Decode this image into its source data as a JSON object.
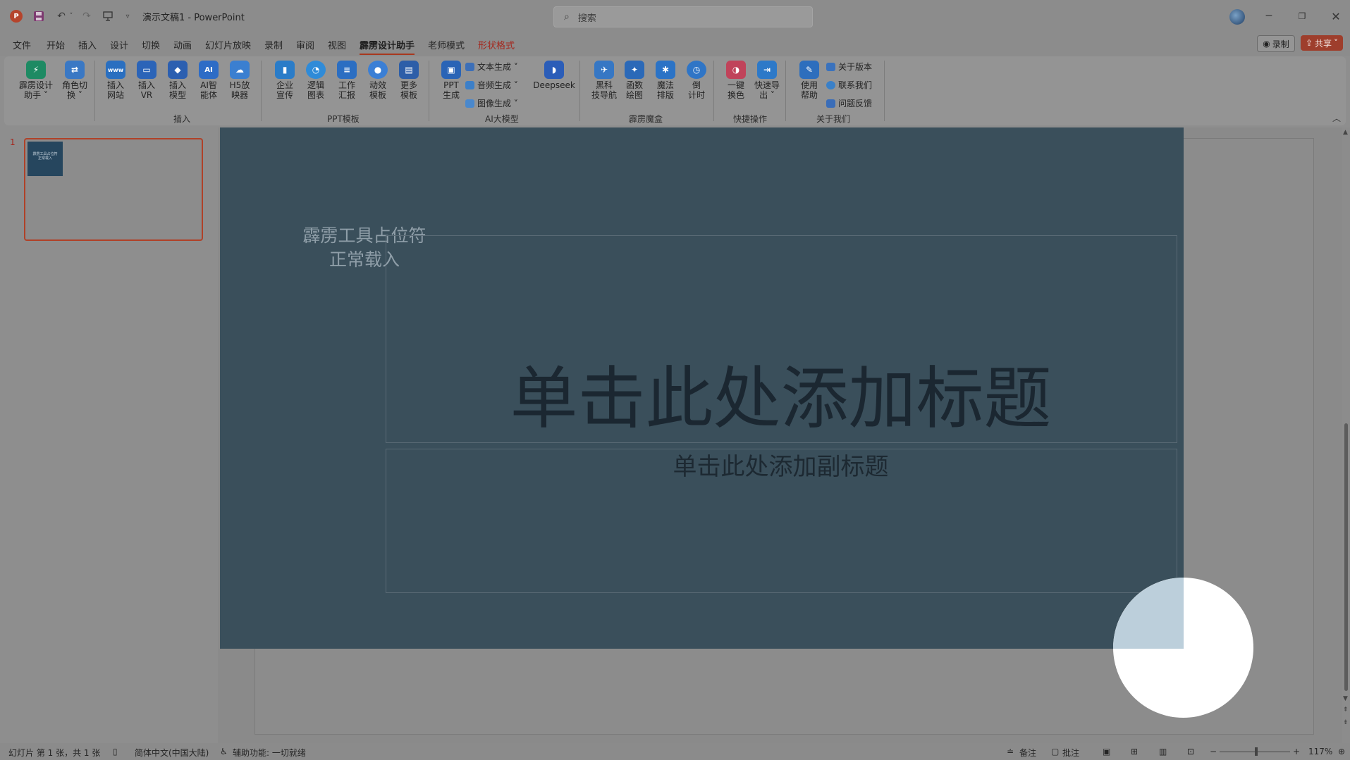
{
  "titlebar": {
    "app_logo": "P",
    "doc_title": "演示文稿1  -  PowerPoint",
    "search_placeholder": "搜索",
    "icons": [
      "save-icon",
      "undo-icon",
      "redo-icon",
      "present-icon",
      "customize-icon"
    ],
    "window_controls": [
      "minimize",
      "restore",
      "close"
    ]
  },
  "menu": {
    "tabs": [
      "文件",
      "开始",
      "插入",
      "设计",
      "切换",
      "动画",
      "幻灯片放映",
      "录制",
      "审阅",
      "视图",
      "霹雳设计助手",
      "老师模式",
      "形状格式"
    ],
    "active_tab": "霹雳设计助手",
    "record_label": "录制",
    "share_label": "共享"
  },
  "ribbon": {
    "buttons": [
      {
        "label": "霹雳设计\n助手 ˅",
        "icon": "lightning-icon",
        "color": "#1e8a63"
      },
      {
        "label": "角色切\n换 ˅",
        "icon": "role-switch-icon",
        "color": "#3a78c4"
      },
      {
        "label": "插入\n网站",
        "icon": "www-icon",
        "color": "#2a6fc0"
      },
      {
        "label": "插入\nVR",
        "icon": "vr-icon",
        "color": "#2b64b8"
      },
      {
        "label": "插入\n模型",
        "icon": "cube-icon",
        "color": "#2c5fb0"
      },
      {
        "label": "AI智\n能体",
        "icon": "ai-icon",
        "color": "#2d6cc6"
      },
      {
        "label": "H5放\n映器",
        "icon": "cloud-icon",
        "color": "#3b7fd0"
      },
      {
        "label": "企业\n宣传",
        "icon": "enterprise-icon",
        "color": "#2a7cc8"
      },
      {
        "label": "逻辑\n图表",
        "icon": "logic-chart-icon",
        "color": "#2f8bd8"
      },
      {
        "label": "工作\n汇报",
        "icon": "report-icon",
        "color": "#2b6ec2"
      },
      {
        "label": "动效\n模板",
        "icon": "animation-icon",
        "color": "#3b7fd5"
      },
      {
        "label": "更多\n模板",
        "icon": "more-templates-icon",
        "color": "#2d5ea8"
      },
      {
        "label": "PPT\n生成",
        "icon": "ppt-gen-icon",
        "color": "#2a64b6"
      },
      {
        "label": "Deepseek",
        "icon": "whale-icon",
        "color": "#2b5db8"
      },
      {
        "label": "黑科\n技导航",
        "icon": "nav-icon",
        "color": "#3677c4"
      },
      {
        "label": "函数\n绘图",
        "icon": "function-icon",
        "color": "#2b69b8"
      },
      {
        "label": "魔法\n排版",
        "icon": "magic-icon",
        "color": "#2b73c6"
      },
      {
        "label": "倒\n计时",
        "icon": "timer-icon",
        "color": "#2f75c6"
      },
      {
        "label": "一键\n换色",
        "icon": "color-swap-icon",
        "color": "#c0435a"
      },
      {
        "label": "快速导\n出 ˅",
        "icon": "export-icon",
        "color": "#2d79c8"
      },
      {
        "label": "使用\n帮助",
        "icon": "help-icon",
        "color": "#2d6ebd"
      }
    ],
    "small_buttons": [
      {
        "label": "文本生成 ˅",
        "icon": "text-gen-icon"
      },
      {
        "label": "音频生成 ˅",
        "icon": "audio-gen-icon"
      },
      {
        "label": "图像生成 ˅",
        "icon": "image-gen-icon"
      },
      {
        "label": "关于版本",
        "icon": "about-icon"
      },
      {
        "label": "联系我们",
        "icon": "contact-icon"
      },
      {
        "label": "问题反馈",
        "icon": "feedback-icon"
      }
    ],
    "groups": [
      "插入",
      "PPT模板",
      "AI大模型",
      "霹雳魔盒",
      "快捷操作",
      "关于我们"
    ]
  },
  "thumbnails": {
    "slide_number": "1",
    "thumb_text": "霹雳工具占位符\n正常载入"
  },
  "slide": {
    "placeholder_label_line1": "霹雳工具占位符",
    "placeholder_label_line2": "正常载入",
    "title": "单击此处添加标题",
    "subtitle": "单击此处添加副标题"
  },
  "statusbar": {
    "slide_info": "幻灯片 第 1 张，共 1 张",
    "language": "简体中文(中国大陆)",
    "accessibility": "辅助功能: 一切就绪",
    "notes": "备注",
    "comments": "批注",
    "zoom": "117%"
  },
  "colors": {
    "accent_red": "#a8381e",
    "overlay": "#3a4f5b",
    "title_text": "#1b2731"
  }
}
